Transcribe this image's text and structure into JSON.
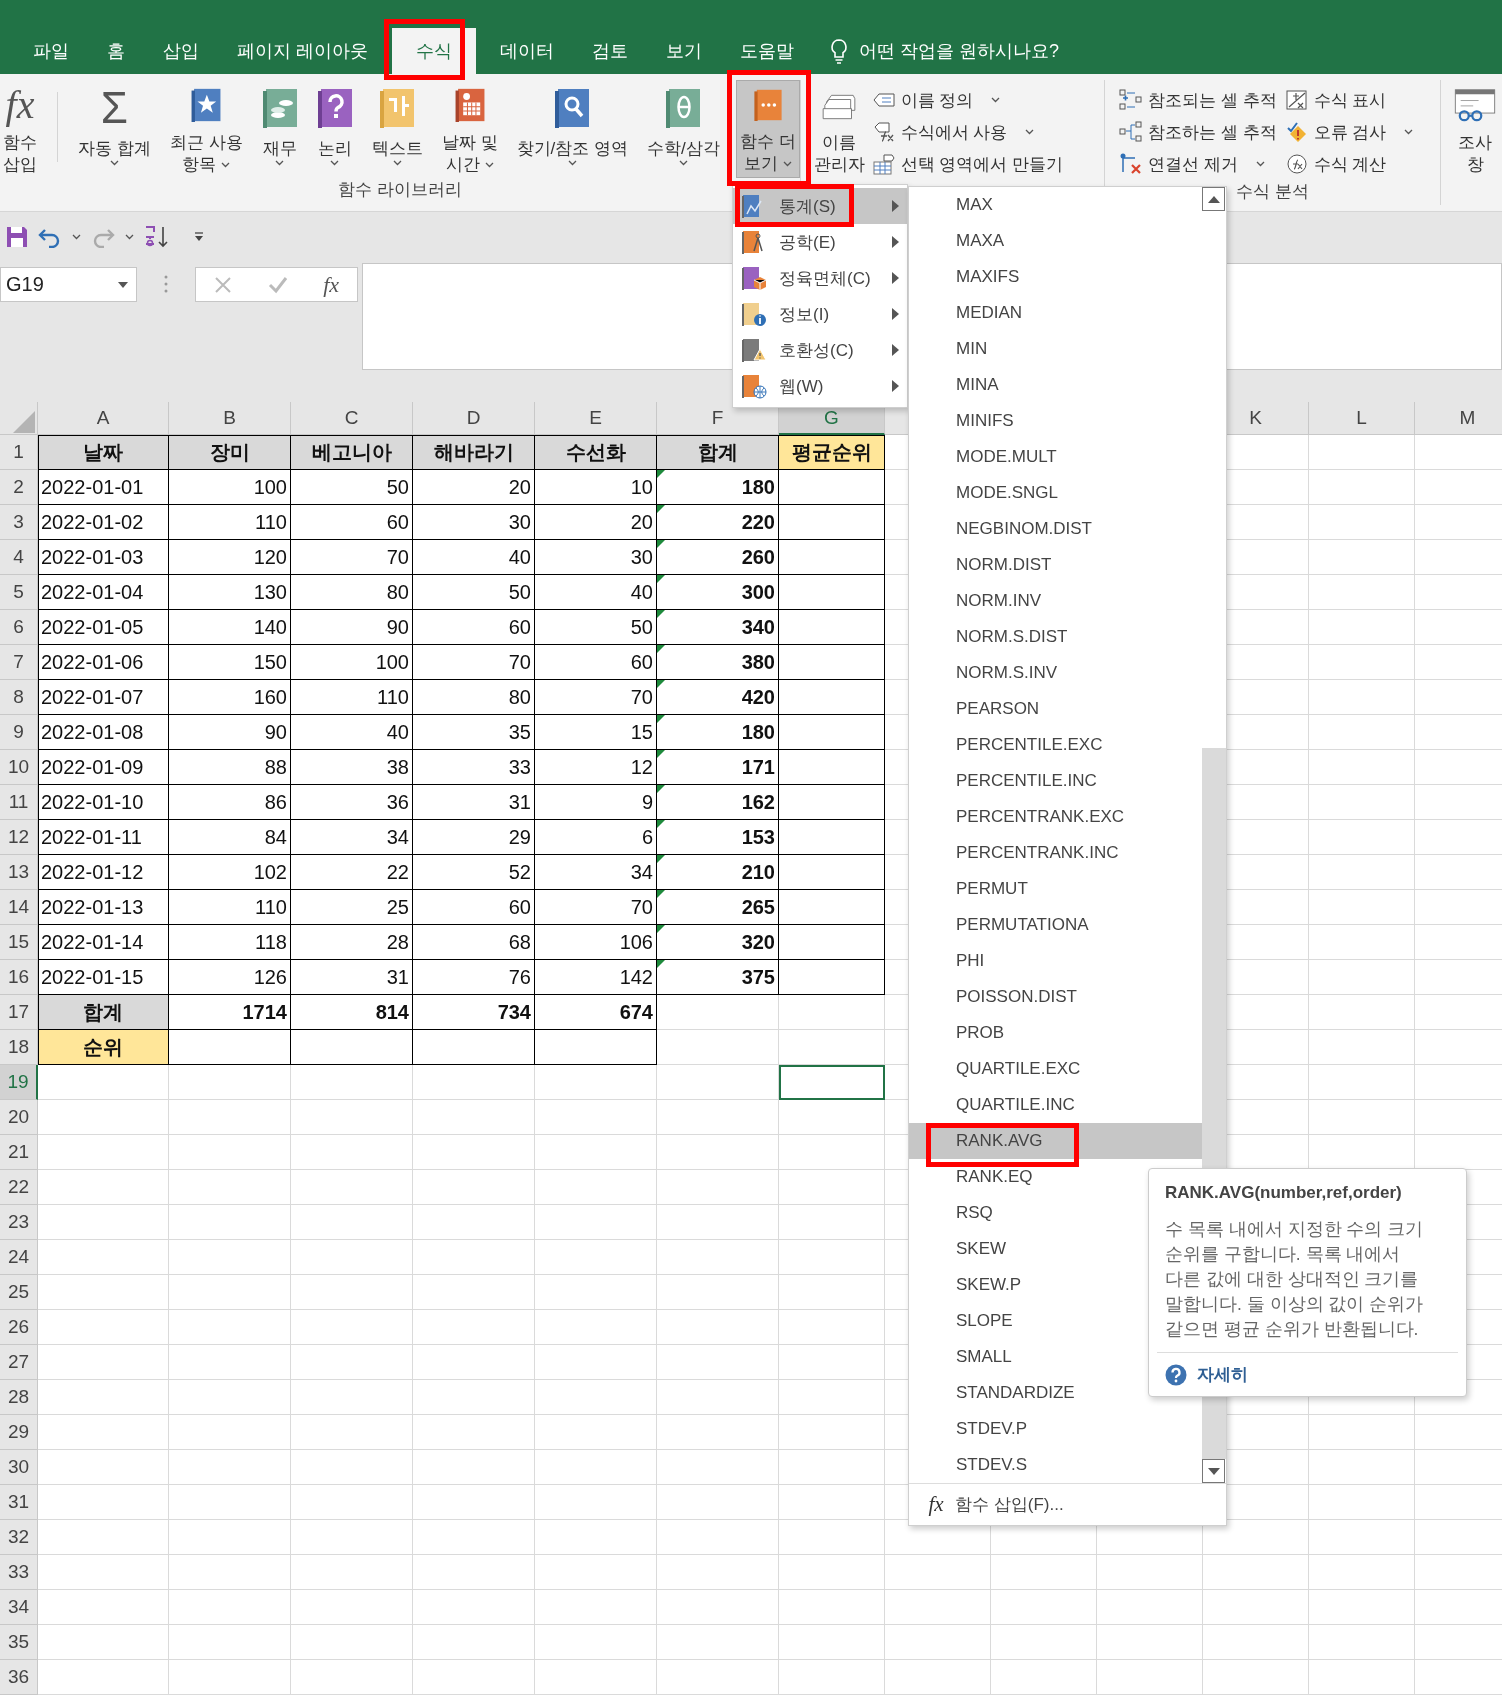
{
  "tabs": [
    {
      "label": "파일",
      "selected": false
    },
    {
      "label": "홈",
      "selected": false
    },
    {
      "label": "삽입",
      "selected": false
    },
    {
      "label": "페이지 레이아웃",
      "selected": false
    },
    {
      "label": "수식",
      "selected": true
    },
    {
      "label": "데이터",
      "selected": false
    },
    {
      "label": "검토",
      "selected": false
    },
    {
      "label": "보기",
      "selected": false
    },
    {
      "label": "도움말",
      "selected": false
    }
  ],
  "tell_me": {
    "placeholder": "어떤 작업을 원하시나요?"
  },
  "ribbon": {
    "library": {
      "label": "함수 라이브러리",
      "buttons": [
        {
          "glyph": "fx",
          "lines": [
            "함수",
            "삽입"
          ],
          "dropdown": false,
          "pressed": false
        },
        {
          "glyph": "Σ",
          "lines": [
            "자동 합계"
          ],
          "dropdown": true,
          "pressed": false
        },
        {
          "lines": [
            "최근 사용",
            "항목"
          ],
          "dropdown": true,
          "pressed": false
        },
        {
          "lines": [
            "재무"
          ],
          "dropdown": true,
          "pressed": false
        },
        {
          "lines": [
            "논리"
          ],
          "dropdown": true,
          "pressed": false
        },
        {
          "lines": [
            "텍스트"
          ],
          "dropdown": true,
          "pressed": false
        },
        {
          "lines": [
            "날짜 및",
            "시간"
          ],
          "dropdown": true,
          "pressed": false
        },
        {
          "lines": [
            "찾기/참조 영역"
          ],
          "dropdown": true,
          "pressed": false
        },
        {
          "lines": [
            "수학/삼각"
          ],
          "dropdown": true,
          "pressed": false
        },
        {
          "lines": [
            "함수 더",
            "보기"
          ],
          "dropdown": true,
          "pressed": true
        }
      ]
    },
    "names": {
      "manager": {
        "lines": [
          "이름",
          "관리자"
        ]
      },
      "buttons": [
        {
          "label": "이름 정의",
          "dropdown": true
        },
        {
          "label": "수식에서 사용",
          "dropdown": true
        },
        {
          "label": "선택 영역에서 만들기",
          "dropdown": false
        }
      ]
    },
    "auditing": {
      "label": "수식 분석",
      "buttons": [
        {
          "label": "참조되는 셀 추적",
          "dropdown": false
        },
        {
          "label": "참조하는 셀 추적",
          "dropdown": false
        },
        {
          "label": "연결선 제거",
          "dropdown": true
        },
        {
          "label": "수식 표시",
          "dropdown": false
        },
        {
          "label": "오류 검사",
          "dropdown": true
        },
        {
          "label": "수식 계산",
          "dropdown": false
        }
      ]
    },
    "watch": {
      "lines": [
        "조사",
        "창"
      ]
    }
  },
  "name_box": {
    "value": "G19"
  },
  "formula_bar": {
    "glyph": "fx"
  },
  "columns": [
    {
      "label": "A",
      "selected": false
    },
    {
      "label": "B",
      "selected": false
    },
    {
      "label": "C",
      "selected": false
    },
    {
      "label": "D",
      "selected": false
    },
    {
      "label": "E",
      "selected": false
    },
    {
      "label": "F",
      "selected": false
    },
    {
      "label": "G",
      "selected": true
    },
    {
      "selected": false
    },
    {},
    {},
    {
      "label": "K",
      "selected": false
    },
    {
      "label": "L",
      "selected": false
    },
    {
      "label": "M",
      "selected": false
    }
  ],
  "rows": [
    {
      "number": "1",
      "selected": false,
      "kind": "header",
      "cells": [
        {
          "text": "날짜",
          "color": "#d9d9d9"
        },
        {
          "text": "장미",
          "color": "#d9d9d9"
        },
        {
          "text": "베고니아",
          "color": "#d9d9d9"
        },
        {
          "text": "해바라기",
          "color": "#d9d9d9"
        },
        {
          "text": "수선화",
          "color": "#d9d9d9"
        },
        {
          "text": "합계",
          "color": "#d9d9d9"
        },
        {
          "text": "평균순위",
          "color": "#ffe699"
        }
      ]
    },
    {
      "number": "2",
      "selected": false,
      "kind": "data",
      "cells": [
        {
          "text": "2022-01-01"
        },
        {
          "text": "100"
        },
        {
          "text": "50"
        },
        {
          "text": "20"
        },
        {
          "text": "10"
        },
        {
          "text": "180",
          "error_mark": true
        }
      ]
    },
    {
      "number": "3",
      "selected": false,
      "kind": "data",
      "cells": [
        {
          "text": "2022-01-02"
        },
        {
          "text": "110"
        },
        {
          "text": "60"
        },
        {
          "text": "30"
        },
        {
          "text": "20"
        },
        {
          "text": "220",
          "error_mark": true
        }
      ]
    },
    {
      "number": "4",
      "selected": false,
      "kind": "data",
      "cells": [
        {
          "text": "2022-01-03"
        },
        {
          "text": "120"
        },
        {
          "text": "70"
        },
        {
          "text": "40"
        },
        {
          "text": "30"
        },
        {
          "text": "260",
          "error_mark": true
        }
      ]
    },
    {
      "number": "5",
      "selected": false,
      "kind": "data",
      "cells": [
        {
          "text": "2022-01-04"
        },
        {
          "text": "130"
        },
        {
          "text": "80"
        },
        {
          "text": "50"
        },
        {
          "text": "40"
        },
        {
          "text": "300",
          "error_mark": true
        }
      ]
    },
    {
      "number": "6",
      "selected": false,
      "kind": "data",
      "cells": [
        {
          "text": "2022-01-05"
        },
        {
          "text": "140"
        },
        {
          "text": "90"
        },
        {
          "text": "60"
        },
        {
          "text": "50"
        },
        {
          "text": "340",
          "error_mark": true
        }
      ]
    },
    {
      "number": "7",
      "selected": false,
      "kind": "data",
      "cells": [
        {
          "text": "2022-01-06"
        },
        {
          "text": "150"
        },
        {
          "text": "100"
        },
        {
          "text": "70"
        },
        {
          "text": "60"
        },
        {
          "text": "380",
          "error_mark": true
        }
      ]
    },
    {
      "number": "8",
      "selected": false,
      "kind": "data",
      "cells": [
        {
          "text": "2022-01-07"
        },
        {
          "text": "160"
        },
        {
          "text": "110"
        },
        {
          "text": "80"
        },
        {
          "text": "70"
        },
        {
          "text": "420",
          "error_mark": true
        }
      ]
    },
    {
      "number": "9",
      "selected": false,
      "kind": "data",
      "cells": [
        {
          "text": "2022-01-08"
        },
        {
          "text": "90"
        },
        {
          "text": "40"
        },
        {
          "text": "35"
        },
        {
          "text": "15"
        },
        {
          "text": "180",
          "error_mark": true
        }
      ]
    },
    {
      "number": "10",
      "selected": false,
      "kind": "data",
      "cells": [
        {
          "text": "2022-01-09"
        },
        {
          "text": "88"
        },
        {
          "text": "38"
        },
        {
          "text": "33"
        },
        {
          "text": "12"
        },
        {
          "text": "171",
          "error_mark": true
        }
      ]
    },
    {
      "number": "11",
      "selected": false,
      "kind": "data",
      "cells": [
        {
          "text": "2022-01-10"
        },
        {
          "text": "86"
        },
        {
          "text": "36"
        },
        {
          "text": "31"
        },
        {
          "text": "9"
        },
        {
          "text": "162",
          "error_mark": true
        }
      ]
    },
    {
      "number": "12",
      "selected": false,
      "kind": "data",
      "cells": [
        {
          "text": "2022-01-11"
        },
        {
          "text": "84"
        },
        {
          "text": "34"
        },
        {
          "text": "29"
        },
        {
          "text": "6"
        },
        {
          "text": "153",
          "error_mark": true
        }
      ]
    },
    {
      "number": "13",
      "selected": false,
      "kind": "data",
      "cells": [
        {
          "text": "2022-01-12"
        },
        {
          "text": "102"
        },
        {
          "text": "22"
        },
        {
          "text": "52"
        },
        {
          "text": "34"
        },
        {
          "text": "210",
          "error_mark": true
        }
      ]
    },
    {
      "number": "14",
      "selected": false,
      "kind": "data",
      "cells": [
        {
          "text": "2022-01-13"
        },
        {
          "text": "110"
        },
        {
          "text": "25"
        },
        {
          "text": "60"
        },
        {
          "text": "70"
        },
        {
          "text": "265",
          "error_mark": true
        }
      ]
    },
    {
      "number": "15",
      "selected": false,
      "kind": "data",
      "cells": [
        {
          "text": "2022-01-14"
        },
        {
          "text": "118"
        },
        {
          "text": "28"
        },
        {
          "text": "68"
        },
        {
          "text": "106"
        },
        {
          "text": "320",
          "error_mark": true
        }
      ]
    },
    {
      "number": "16",
      "selected": false,
      "kind": "data",
      "cells": [
        {
          "text": "2022-01-15"
        },
        {
          "text": "126"
        },
        {
          "text": "31"
        },
        {
          "text": "76"
        },
        {
          "text": "142"
        },
        {
          "text": "375",
          "error_mark": true
        }
      ]
    },
    {
      "number": "17",
      "selected": false,
      "kind": "total",
      "cells": [
        {
          "text": "합계",
          "color": "#d9d9d9"
        },
        {
          "text": "1714"
        },
        {
          "text": "814"
        },
        {
          "text": "734"
        },
        {
          "text": "674"
        }
      ]
    },
    {
      "number": "18",
      "selected": false,
      "kind": "rank",
      "cells": [
        {
          "text": "순위",
          "color": "#ffe699"
        }
      ]
    },
    {
      "number": "19",
      "selected": true
    },
    {
      "number": "20",
      "selected": false
    },
    {
      "number": "21",
      "selected": false
    },
    {
      "number": "22",
      "selected": false
    },
    {
      "number": "23",
      "selected": false
    },
    {
      "number": "24",
      "selected": false
    },
    {
      "number": "25",
      "selected": false
    },
    {
      "number": "26",
      "selected": false
    },
    {
      "number": "27",
      "selected": false
    },
    {
      "number": "28",
      "selected": false
    },
    {
      "number": "29",
      "selected": false
    },
    {
      "number": "30",
      "selected": false
    },
    {
      "number": "31",
      "selected": false
    },
    {
      "number": "32",
      "selected": false
    },
    {
      "number": "33",
      "selected": false
    },
    {
      "number": "34",
      "selected": false
    },
    {
      "number": "35",
      "selected": false
    },
    {
      "number": "36",
      "selected": false
    }
  ],
  "category_menu": {
    "items": [
      {
        "label": "통계(S)",
        "selected": true
      },
      {
        "label": "공학(E)",
        "selected": false
      },
      {
        "label": "정육면체(C)",
        "selected": false
      },
      {
        "label": "정보(I)",
        "selected": false
      },
      {
        "label": "호환성(C)",
        "selected": false
      },
      {
        "label": "웹(W)",
        "selected": false
      }
    ]
  },
  "function_menu": {
    "items": [
      {
        "name": "MAX",
        "selected": false
      },
      {
        "name": "MAXA",
        "selected": false
      },
      {
        "name": "MAXIFS",
        "selected": false
      },
      {
        "name": "MEDIAN",
        "selected": false
      },
      {
        "name": "MIN",
        "selected": false
      },
      {
        "name": "MINA",
        "selected": false
      },
      {
        "name": "MINIFS",
        "selected": false
      },
      {
        "name": "MODE.MULT",
        "selected": false
      },
      {
        "name": "MODE.SNGL",
        "selected": false
      },
      {
        "name": "NEGBINOM.DIST",
        "selected": false
      },
      {
        "name": "NORM.DIST",
        "selected": false
      },
      {
        "name": "NORM.INV",
        "selected": false
      },
      {
        "name": "NORM.S.DIST",
        "selected": false
      },
      {
        "name": "NORM.S.INV",
        "selected": false
      },
      {
        "name": "PEARSON",
        "selected": false
      },
      {
        "name": "PERCENTILE.EXC",
        "selected": false
      },
      {
        "name": "PERCENTILE.INC",
        "selected": false
      },
      {
        "name": "PERCENTRANK.EXC",
        "selected": false
      },
      {
        "name": "PERCENTRANK.INC",
        "selected": false
      },
      {
        "name": "PERMUT",
        "selected": false
      },
      {
        "name": "PERMUTATIONA",
        "selected": false
      },
      {
        "name": "PHI",
        "selected": false
      },
      {
        "name": "POISSON.DIST",
        "selected": false
      },
      {
        "name": "PROB",
        "selected": false
      },
      {
        "name": "QUARTILE.EXC",
        "selected": false
      },
      {
        "name": "QUARTILE.INC",
        "selected": false
      },
      {
        "name": "RANK.AVG",
        "selected": true
      },
      {
        "name": "RANK.EQ",
        "selected": false
      },
      {
        "name": "RSQ",
        "selected": false
      },
      {
        "name": "SKEW",
        "selected": false
      },
      {
        "name": "SKEW.P",
        "selected": false
      },
      {
        "name": "SLOPE",
        "selected": false
      },
      {
        "name": "SMALL",
        "selected": false
      },
      {
        "name": "STANDARDIZE",
        "selected": false
      },
      {
        "name": "STDEV.P",
        "selected": false
      },
      {
        "name": "STDEV.S",
        "selected": false
      }
    ],
    "footer": {
      "glyph": "fx",
      "label": "함수 삽입(F)..."
    }
  },
  "tooltip": {
    "title": "RANK.AVG(number,ref,order)",
    "description": "수 목록 내에서 지정한 수의 크기 순위를 구합니다. 목록 내에서 다른 값에 대한 상대적인 크기를 말합니다. 둘 이상의 값이 순위가 같으면 평균 순위가 반환됩니다.",
    "link": "자세히"
  }
}
